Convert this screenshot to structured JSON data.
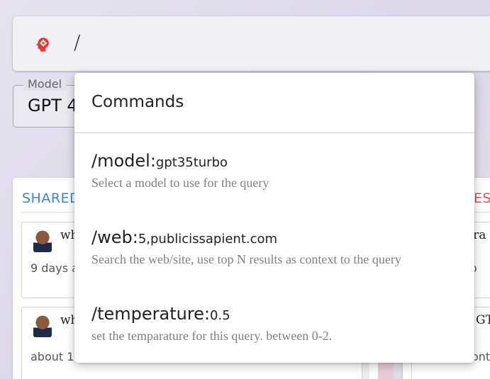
{
  "search": {
    "value": "/",
    "icon": "head-gear-icon",
    "icon_color": "#e53935"
  },
  "model": {
    "legend": "Model",
    "value": "GPT 4"
  },
  "shared_panel": {
    "title": "SHARED",
    "title_color": "#3f86d3",
    "cards": [
      {
        "snippet": "wh",
        "time": "9 days a"
      },
      {
        "snippet": "wh",
        "time": "about 1"
      }
    ]
  },
  "right_panel": {
    "title": "ES",
    "title_color": "#d8574f",
    "cards": [
      {
        "line1": "s ra",
        "line2": "o"
      },
      {
        "line1": "GT",
        "line2": "ontl"
      }
    ]
  },
  "commands": {
    "title": "Commands",
    "items": [
      {
        "name": "/model:",
        "arg": "gpt35turbo",
        "description": "Select a model to use for the query"
      },
      {
        "name": "/web:",
        "arg": "5,publicissapient.com",
        "description": "Search the web/site, use top N results as context to the query"
      },
      {
        "name": "/temperature:",
        "arg": "0.5",
        "description": "set the temparature for this query. between 0-2."
      }
    ]
  }
}
